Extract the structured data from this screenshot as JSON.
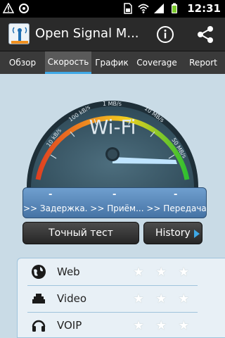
{
  "status_bar": {
    "time": "12:31",
    "icons": [
      "usb-warning-icon",
      "sync-icon",
      "sim-icon",
      "wifi-icon",
      "signal-icon",
      "battery-icon"
    ]
  },
  "action_bar": {
    "title": "Open Signal M...",
    "info_icon": "info-icon",
    "share_icon": "share-icon"
  },
  "tabs": [
    {
      "label": "Обзор",
      "active": false
    },
    {
      "label": "Скорость",
      "active": true
    },
    {
      "label": "График",
      "active": false
    },
    {
      "label": "Coverage",
      "active": false
    },
    {
      "label": "Report",
      "active": false
    }
  ],
  "gauge": {
    "network": "Wi-Fi",
    "scale_labels": [
      "10 kB/s",
      "100 kB/s",
      "1 MB/s",
      "10 MB/s",
      "50 MB/s"
    ],
    "needle_value": "50 MB/s",
    "colors": {
      "low": "#e04020",
      "mid": "#f0d020",
      "high": "#30c030",
      "face": "#3a5766"
    }
  },
  "readout": {
    "values": [
      "-",
      "-",
      "-"
    ],
    "labels": ">> Задержка. >> Приём... >> Передача."
  },
  "buttons": {
    "precise_test": "Точный тест",
    "history": "History"
  },
  "quality": [
    {
      "icon": "globe-icon",
      "label": "Web",
      "stars": 0,
      "max_stars": 3
    },
    {
      "icon": "video-icon",
      "label": "Video",
      "stars": 0,
      "max_stars": 3
    },
    {
      "icon": "headset-icon",
      "label": "VOIP",
      "stars": 0,
      "max_stars": 3
    }
  ]
}
